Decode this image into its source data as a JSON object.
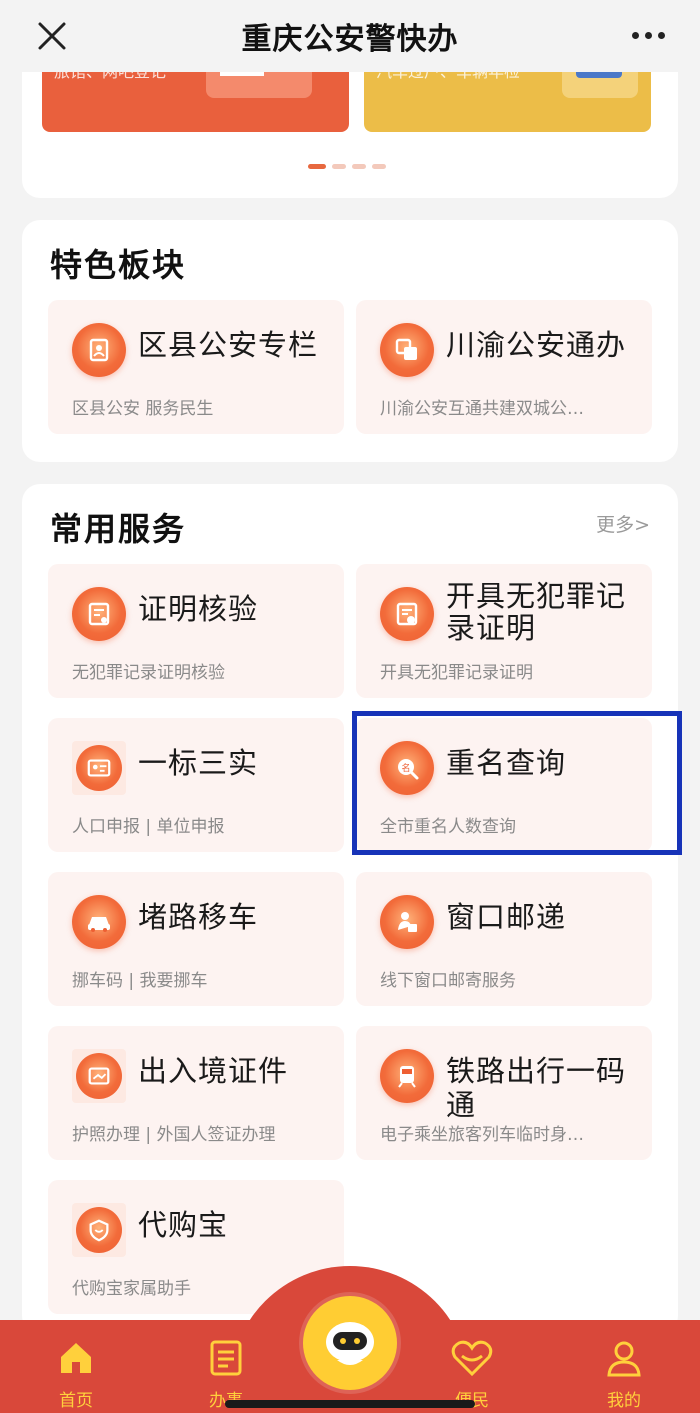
{
  "header": {
    "title": "重庆公安警快办"
  },
  "banner": {
    "left_text": "旅馆、网吧登记",
    "right_text": "汽车过户、车辆年检"
  },
  "featured": {
    "title": "特色板块",
    "items": [
      {
        "name": "区县公安专栏",
        "desc": "区县公安 服务民生"
      },
      {
        "name": "川渝公安通办",
        "desc": "川渝公安互通共建双城公…"
      }
    ]
  },
  "common": {
    "title": "常用服务",
    "more": "更多>",
    "items": [
      {
        "name": "证明核验",
        "desc": "无犯罪记录证明核验"
      },
      {
        "name": "开具无犯罪记录证明",
        "desc": "开具无犯罪记录证明"
      },
      {
        "name": "一标三实",
        "desc": "人口申报 | 单位申报"
      },
      {
        "name": "重名查询",
        "desc": "全市重名人数查询"
      },
      {
        "name": "堵路移车",
        "desc": "挪车码 | 我要挪车"
      },
      {
        "name": "窗口邮递",
        "desc": "线下窗口邮寄服务"
      },
      {
        "name": "出入境证件",
        "desc": "护照办理 | 外国人签证办理"
      },
      {
        "name": "铁路出行一码通",
        "desc": "电子乘坐旅客列车临时身…"
      },
      {
        "name": "代购宝",
        "desc": "代购宝家属助手"
      }
    ]
  },
  "tabbar": {
    "items": [
      {
        "label": "首页"
      },
      {
        "label": "办事"
      },
      {
        "label": "便民"
      },
      {
        "label": "我的"
      }
    ]
  },
  "colors": {
    "accent": "#e9603d",
    "tabbar": "#d9483a",
    "tab_label": "#ffd03c",
    "highlight": "#1733b8"
  }
}
